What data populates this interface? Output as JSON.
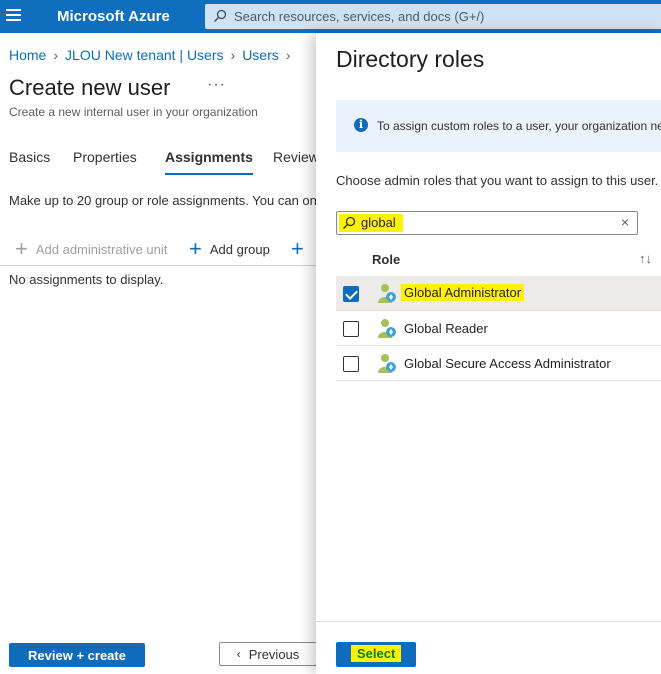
{
  "topbar": {
    "brand": "Microsoft Azure",
    "search_placeholder": "Search resources, services, and docs (G+/)"
  },
  "breadcrumb": [
    "Home",
    "JLOU New tenant | Users",
    "Users"
  ],
  "page": {
    "title": "Create new user",
    "more": "···",
    "subtitle": "Create a new internal user in your organization"
  },
  "tabs": [
    {
      "label": "Basics",
      "active": false
    },
    {
      "label": "Properties",
      "active": false
    },
    {
      "label": "Assignments",
      "active": true
    },
    {
      "label": "Review",
      "active": false
    }
  ],
  "assignments": {
    "intro": "Make up to 20 group or role assignments. You can on",
    "add_admin_unit": "Add administrative unit",
    "add_group": "Add group",
    "empty": "No assignments to display."
  },
  "footer": {
    "review_create": "Review + create",
    "previous": "Previous"
  },
  "panel": {
    "title": "Directory roles",
    "info": "To assign custom roles to a user, your organization ne",
    "choose": "Choose admin roles that you want to assign to this user.",
    "filter_value": "global",
    "column_role": "Role",
    "roles": [
      {
        "label": "Global Administrator",
        "checked": true,
        "highlighted": true
      },
      {
        "label": "Global Reader",
        "checked": false,
        "highlighted": false
      },
      {
        "label": "Global Secure Access Administrator",
        "checked": false,
        "highlighted": false
      }
    ],
    "select": "Select"
  },
  "colors": {
    "accent": "#0f6cbd",
    "highlight": "#fff200"
  }
}
